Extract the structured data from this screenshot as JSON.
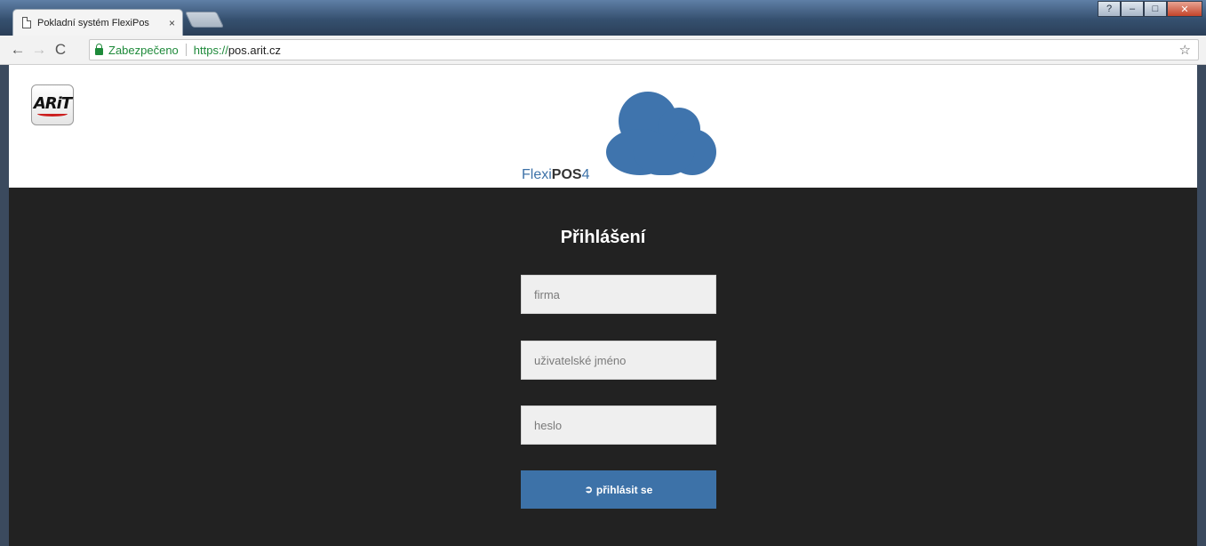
{
  "browser": {
    "tab_title": "Pokladní systém FlexiPos",
    "tab_close": "×",
    "window_buttons": {
      "help": "?",
      "minimize": "–",
      "maximize": "□",
      "close": "✕"
    },
    "nav": {
      "back": "←",
      "forward": "→",
      "reload": "C"
    },
    "secure_label": "Zabezpečeno",
    "url_scheme": "https://",
    "url_host": "pos.arit.cz",
    "bookmark": "☆"
  },
  "header": {
    "logo_text": "ARiT",
    "brand_prefix": "Flexi",
    "brand_bold": "POS",
    "brand_version": "4"
  },
  "login": {
    "title": "Přihlášení",
    "company_placeholder": "firma",
    "username_placeholder": "uživatelské jméno",
    "password_placeholder": "heslo",
    "submit_icon": "➲",
    "submit_label": "přihlásit se"
  },
  "colors": {
    "accent": "#3d72a8",
    "login_background": "#222222",
    "secure": "#1e8a3a"
  }
}
